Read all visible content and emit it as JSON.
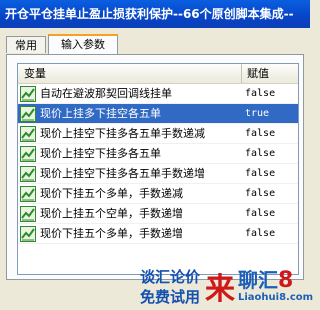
{
  "window": {
    "title": "开仓平仓挂单止盈止损获利保护--66个原创脚本集成--"
  },
  "tabs": [
    {
      "label": "常用",
      "active": false
    },
    {
      "label": "输入参数",
      "active": true
    }
  ],
  "grid": {
    "columns": {
      "variable": "变量",
      "value": "赋值"
    },
    "rows": [
      {
        "name": "自动在避波那契回调线挂单",
        "value": "false",
        "selected": false
      },
      {
        "name": "现价上挂多下挂空各五单",
        "value": "true",
        "selected": true
      },
      {
        "name": "现价上挂空下挂多各五单手数递减",
        "value": "false",
        "selected": false
      },
      {
        "name": "现价上挂空下挂多各五单",
        "value": "false",
        "selected": false
      },
      {
        "name": "现价上挂空下挂多各五单手数递增",
        "value": "false",
        "selected": false
      },
      {
        "name": "现价下挂五个多单，手数递减",
        "value": "false",
        "selected": false
      },
      {
        "name": "现价上挂五个空单，手数递增",
        "value": "false",
        "selected": false
      },
      {
        "name": "现价下挂五个多单，手数递增",
        "value": "false",
        "selected": false
      }
    ]
  },
  "watermark": {
    "line1": "谈汇论价",
    "line2": "免费试用",
    "logo_lai": "来",
    "logo_liaohui": "聊汇",
    "logo_8": "8",
    "logo_url": "Liaohui8.com"
  },
  "colors": {
    "title_bar": "#0a4fd1",
    "selection": "#316ac5",
    "icon_green": "#2f8a2f",
    "watermark_red": "#d01818",
    "watermark_blue": "#1c5fb8"
  }
}
